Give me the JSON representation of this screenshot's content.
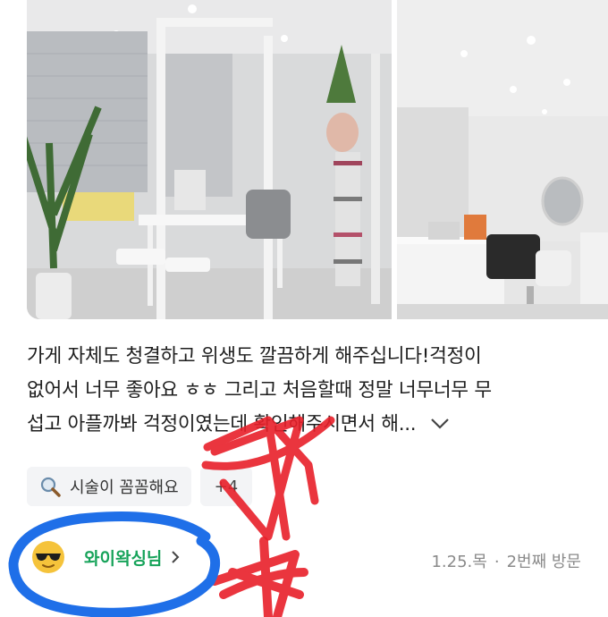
{
  "review": {
    "text": "가게 자체도 청결하고 위생도 깔끔하게 해주십니다!걱정이\n없어서 너무 좋아요 ㅎㅎ 그리고 처음할때 정말 너무너무 무\n섭고 아플까봐 걱정이였는데 확인해주시면서 해..."
  },
  "tags": [
    {
      "label": "시술이 꼼꼼해요",
      "icon": "magnifier-icon"
    },
    {
      "label": "+4"
    }
  ],
  "author": {
    "nickname": "와이왁싱님",
    "avatar_icon": "sunglasses-emoji-icon"
  },
  "meta": {
    "date": "1.25.목",
    "separator": "·",
    "visit": "2번째 방문"
  },
  "colors": {
    "nickname": "#17a35a",
    "annotation_red": "#e8202a",
    "annotation_blue": "#1f6fe8"
  }
}
